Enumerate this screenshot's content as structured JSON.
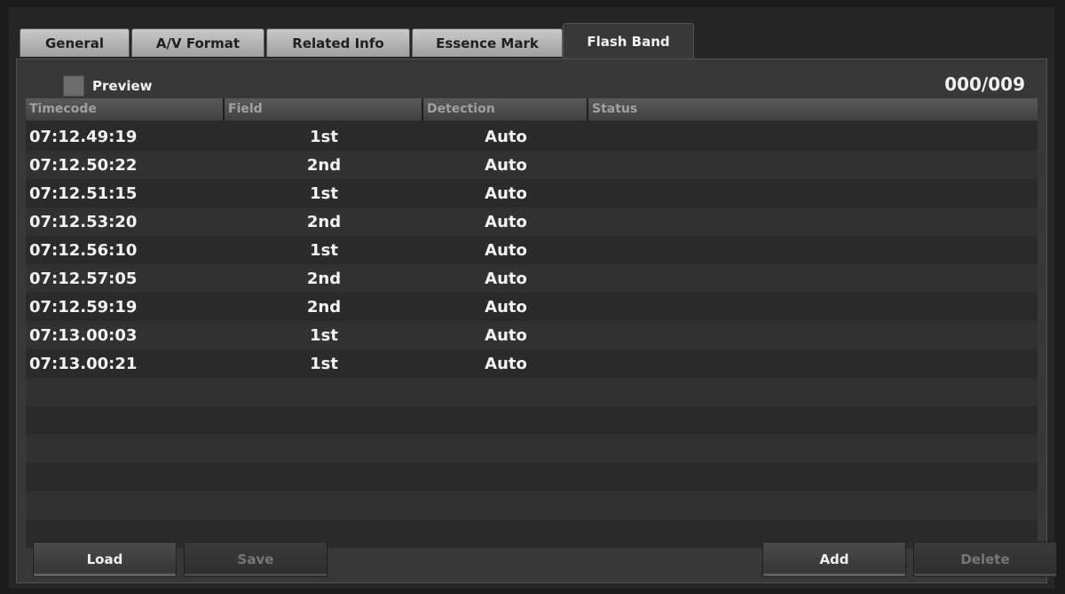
{
  "tabs": [
    {
      "label": "General",
      "active": false
    },
    {
      "label": "A/V Format",
      "active": false
    },
    {
      "label": "Related Info",
      "active": false
    },
    {
      "label": "Essence Mark",
      "active": false
    },
    {
      "label": "Flash Band",
      "active": true
    }
  ],
  "panel": {
    "preview_label": "Preview",
    "preview_checked": false,
    "counter": "000/009"
  },
  "table": {
    "columns": [
      "Timecode",
      "Field",
      "Detection",
      "Status"
    ],
    "rows": [
      {
        "timecode": "07:12.49:19",
        "field": "1st",
        "detection": "Auto",
        "status": ""
      },
      {
        "timecode": "07:12.50:22",
        "field": "2nd",
        "detection": "Auto",
        "status": ""
      },
      {
        "timecode": "07:12.51:15",
        "field": "1st",
        "detection": "Auto",
        "status": ""
      },
      {
        "timecode": "07:12.53:20",
        "field": "2nd",
        "detection": "Auto",
        "status": ""
      },
      {
        "timecode": "07:12.56:10",
        "field": "1st",
        "detection": "Auto",
        "status": ""
      },
      {
        "timecode": "07:12.57:05",
        "field": "2nd",
        "detection": "Auto",
        "status": ""
      },
      {
        "timecode": "07:12.59:19",
        "field": "2nd",
        "detection": "Auto",
        "status": ""
      },
      {
        "timecode": "07:13.00:03",
        "field": "1st",
        "detection": "Auto",
        "status": ""
      },
      {
        "timecode": "07:13.00:21",
        "field": "1st",
        "detection": "Auto",
        "status": ""
      }
    ],
    "empty_rows": 6
  },
  "buttons": {
    "load": {
      "label": "Load",
      "enabled": true
    },
    "save": {
      "label": "Save",
      "enabled": false
    },
    "add": {
      "label": "Add",
      "enabled": true
    },
    "delete": {
      "label": "Delete",
      "enabled": false
    }
  }
}
